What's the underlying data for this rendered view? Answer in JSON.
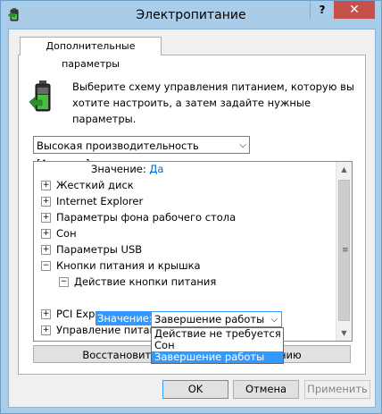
{
  "window": {
    "title": "Электропитание",
    "help_label": "?",
    "close_label": "✕"
  },
  "tab": {
    "label": "Дополнительные параметры"
  },
  "description": "Выберите схему управления питанием, которую вы хотите настроить, а затем задайте нужные параметры.",
  "scheme_select": {
    "value": "Высокая производительность [Активен]"
  },
  "tree": {
    "value_row": {
      "label": "Значение:",
      "value": "Да"
    },
    "items": [
      {
        "label": "Жесткий диск",
        "expander": "+"
      },
      {
        "label": "Internet Explorer",
        "expander": "+"
      },
      {
        "label": "Параметры фона рабочего стола",
        "expander": "+"
      },
      {
        "label": "Сон",
        "expander": "+"
      },
      {
        "label": "Параметры USB",
        "expander": "+"
      },
      {
        "label": "Кнопки питания и крышка",
        "expander": "−"
      },
      {
        "label": "Действие кнопки питания",
        "expander": "−"
      },
      {
        "label": "PCI Express",
        "expander": "+"
      },
      {
        "label": "Управление питанием процессора",
        "expander": "+"
      }
    ],
    "edit_value_label": "Значение:",
    "edit_value": "Завершение работы"
  },
  "dropdown": {
    "options": [
      "Действие не требуется",
      "Сон",
      "Завершение работы"
    ],
    "selected_index": 2
  },
  "restore_button": "Восстановить параметры по умолчанию",
  "buttons": {
    "ok": "OK",
    "cancel": "Отмена",
    "apply": "Применить"
  },
  "colors": {
    "titlebar": "#a9cde9",
    "close": "#c7504b",
    "selection": "#3399ff",
    "link": "#0066cc"
  }
}
